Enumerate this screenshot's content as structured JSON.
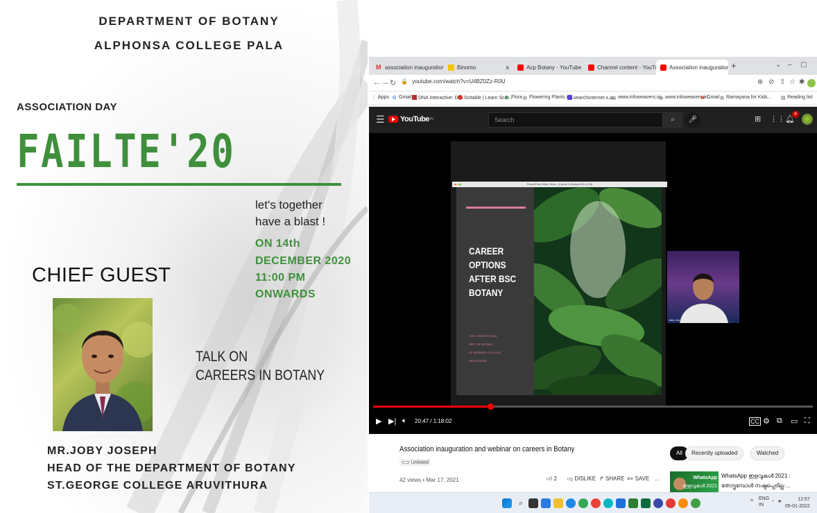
{
  "poster": {
    "dept_line1": "DEPARTMENT OF BOTANY",
    "dept_line2": "ALPHONSA COLLEGE PALA",
    "event_label": "ASSOCIATION DAY",
    "event_name": "FAILTE'20",
    "tagline_line1": "let's together",
    "tagline_line2": "have a blast !",
    "date_line1": "ON 14th",
    "date_line2": "DECEMBER 2020",
    "date_line3": "11:00 PM",
    "date_line4": "ONWARDS",
    "chief_guest_label": "CHIEF GUEST",
    "talk_line1": "TALK ON",
    "talk_line2": "CAREERS IN BOTANY",
    "guest_name": "MR.JOBY JOSEPH",
    "guest_role": "HEAD OF THE DEPARTMENT OF BOTANY",
    "guest_college": "ST.GEORGE COLLEGE ARUVITHURA",
    "accent_color": "#3f8f3c"
  },
  "browser": {
    "tabs": [
      {
        "label": "association inauguration - acpb",
        "icon": "gmail-icon"
      },
      {
        "label": "Binomo",
        "icon": "binomo-icon"
      },
      {
        "label": "Acp Botany - YouTube",
        "icon": "youtube-icon"
      },
      {
        "label": "Channel content - YouTube Studi",
        "icon": "youtube-studio-icon"
      },
      {
        "label": "Association inauguration and we",
        "icon": "youtube-icon"
      }
    ],
    "url": "youtube.com/watch?v=U4BZ0Zz-R0U",
    "bookmarks": [
      "Apps",
      "Gmail",
      "DNA Interactive: Di...",
      "Scitable | Learn Scie...",
      "Flora",
      "Flowering Plants of...",
      "searchinternet-s.a...",
      "www.infoweavers.in...",
      "www.infoweavers.in...",
      "Gmail",
      "Ramayana for Kids...",
      "Reading list"
    ]
  },
  "youtube": {
    "logo_text": "YouTube",
    "logo_region": "IN",
    "search_placeholder": "Search",
    "notification_count": "6",
    "slide_window_title": "PowerPoint Slide Show - [Career in Botany 09-12-20]",
    "slide_heading_lines": [
      "CAREER",
      "OPTIONS",
      "AFTER BSC",
      "BOTANY"
    ],
    "slide_small_lines": [
      "JOBY JOSEPH (HOD)",
      "DEPT OF BOTANY",
      "ST GEORGES COLLEGE",
      "ARUVITHURA"
    ],
    "webcam_name": "Joby Jos",
    "time_display": "20:47 / 1:18:02",
    "progress": 0.266,
    "video_title": "Association inauguration and webinar on careers in Botany",
    "unlisted_label": "Unlisted",
    "views_date": "42 views • Mar 17, 2021",
    "like_count": "2",
    "dislike_label": "DISLIKE",
    "share_label": "SHARE",
    "save_label": "SAVE",
    "more_label": "...",
    "chips": [
      "All",
      "Recently uploaded",
      "Watched"
    ],
    "rec_title_line1": "WhatsApp ഇളവുകൾ 2021 :",
    "rec_title_line2": "തോട്ടുമ്പോൾ നഷ്ടപ്പെടില്ല ...",
    "rec_thumb_line1": "WhatsApp",
    "rec_thumb_line2": "ഇളവുകൾ 2021"
  },
  "taskbar": {
    "lang_line1": "ENG",
    "lang_line2": "IN",
    "time": "12:57",
    "date": "05-01-2022"
  }
}
